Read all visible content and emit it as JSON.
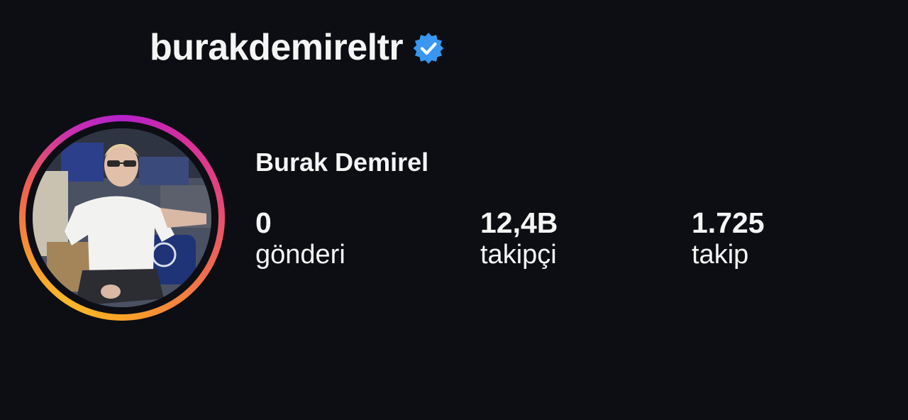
{
  "profile": {
    "username": "burakdemireltr",
    "verified": true,
    "full_name": "Burak Demirel",
    "avatar": "profile-photo"
  },
  "stats": [
    {
      "value": "0",
      "label": "gönderi"
    },
    {
      "value": "12,4B",
      "label": "takipçi"
    },
    {
      "value": "1.725",
      "label": "takip"
    }
  ],
  "colors": {
    "background": "#0c0e13",
    "text": "#f5f5f5",
    "verified_badge": "#3897f0",
    "story_ring_start": "#b321c9",
    "story_ring_end": "#fbb82b"
  },
  "icons": {
    "verified": "verified-badge-icon"
  }
}
